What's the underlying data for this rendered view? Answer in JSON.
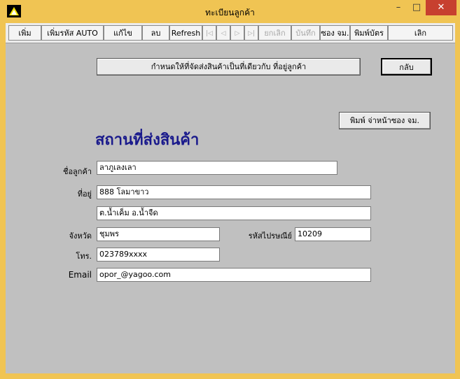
{
  "window": {
    "title": "ทะเบียนลูกค้า",
    "icon": "yellow-triangle-icon",
    "controls": {
      "minimize": "–",
      "maximize": "□",
      "close": "✕"
    }
  },
  "toolbar": {
    "add": "เพิ่ม",
    "add_auto": "เพิ่มรหัส AUTO",
    "edit": "แก้ไข",
    "delete": "ลบ",
    "refresh": "Refresh",
    "nav_first": "|◁",
    "nav_prev": "◁",
    "nav_next": "▷",
    "nav_last": "▷|",
    "cancel": "ยกเลิก",
    "save": "บันทึก",
    "envelope": "ซอง จม.",
    "print_card": "พิมพ์บัตร",
    "exit": "เลิก"
  },
  "actions": {
    "same_as_address": "กำหนดให้ที่จัดส่งสินค้าเป็นที่เดียวกับ ที่อยู่ลูกค้า",
    "back": "กลับ",
    "print_envelope": "พิมพ์ จ่าหน้าซอง จม."
  },
  "form": {
    "heading": "สถานที่ส่งสินค้า",
    "customer_name_label": "ชื่อลูกค้า",
    "customer_name": "ลาภูเลงเลา",
    "address_label": "ที่อยู่",
    "address_line1": "888 โลมาขาว",
    "address_line2": "ต.น้ำเค็ม  อ.น้ำจืด",
    "province_label": "จังหวัด",
    "province": "ชุมพร",
    "postcode_label": "รหัสไปรษณีย์",
    "postcode": "10209",
    "phone_label": "โทร.",
    "phone": "023789xxxx",
    "email_label": "Email",
    "email": "opor_@yagoo.com"
  }
}
